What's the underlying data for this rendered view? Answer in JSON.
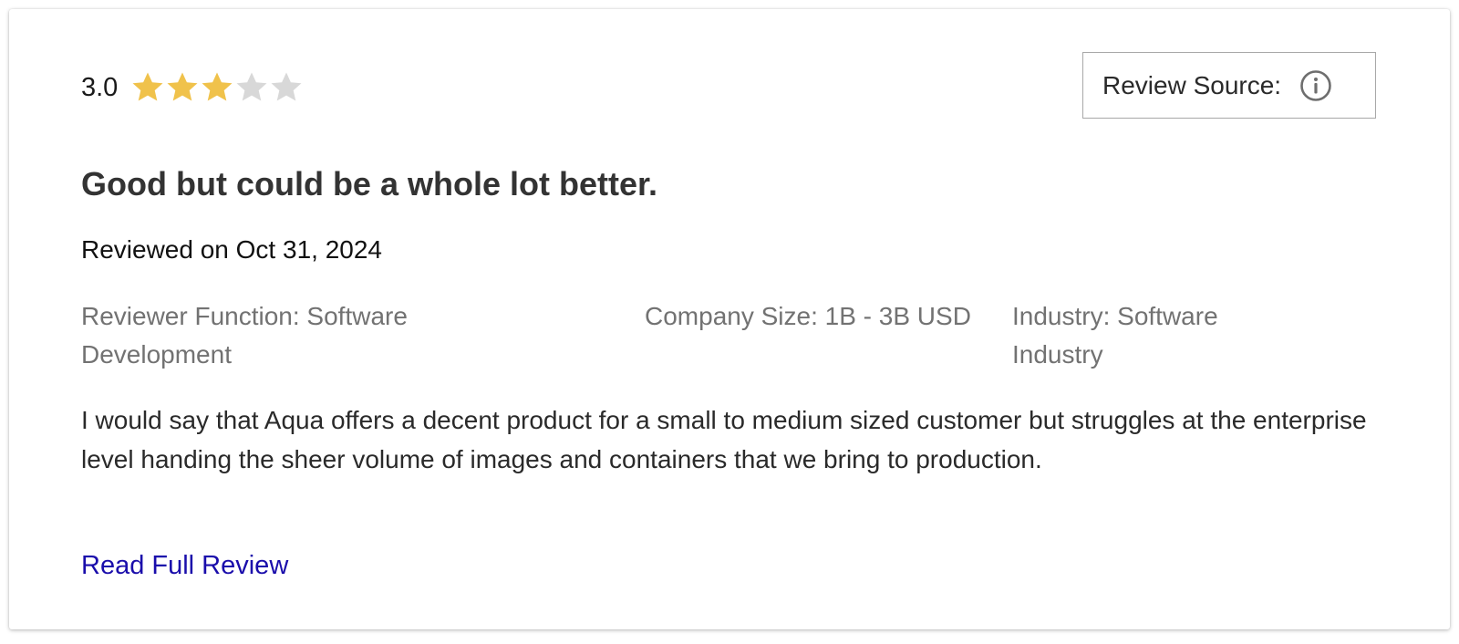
{
  "review": {
    "rating_value": "3.0",
    "rating": 3,
    "rating_max": 5,
    "star_color_filled": "#f0c24b",
    "star_color_empty": "#d8d8d8",
    "source_label": "Review Source:",
    "source_icon": "info-icon",
    "title": "Good but could be a whole lot better.",
    "reviewed_on": "Reviewed on Oct 31, 2024",
    "reviewer_function": "Reviewer Function: Software Development",
    "company_size": "Company Size: 1B - 3B USD",
    "industry": "Industry: Software Industry",
    "body": "I would say that Aqua offers a decent product for a small to medium sized customer but struggles at the enterprise level handing the sheer volume of images and containers that we bring to production.",
    "read_more_label": "Read Full Review",
    "link_color": "#1a0dab"
  }
}
